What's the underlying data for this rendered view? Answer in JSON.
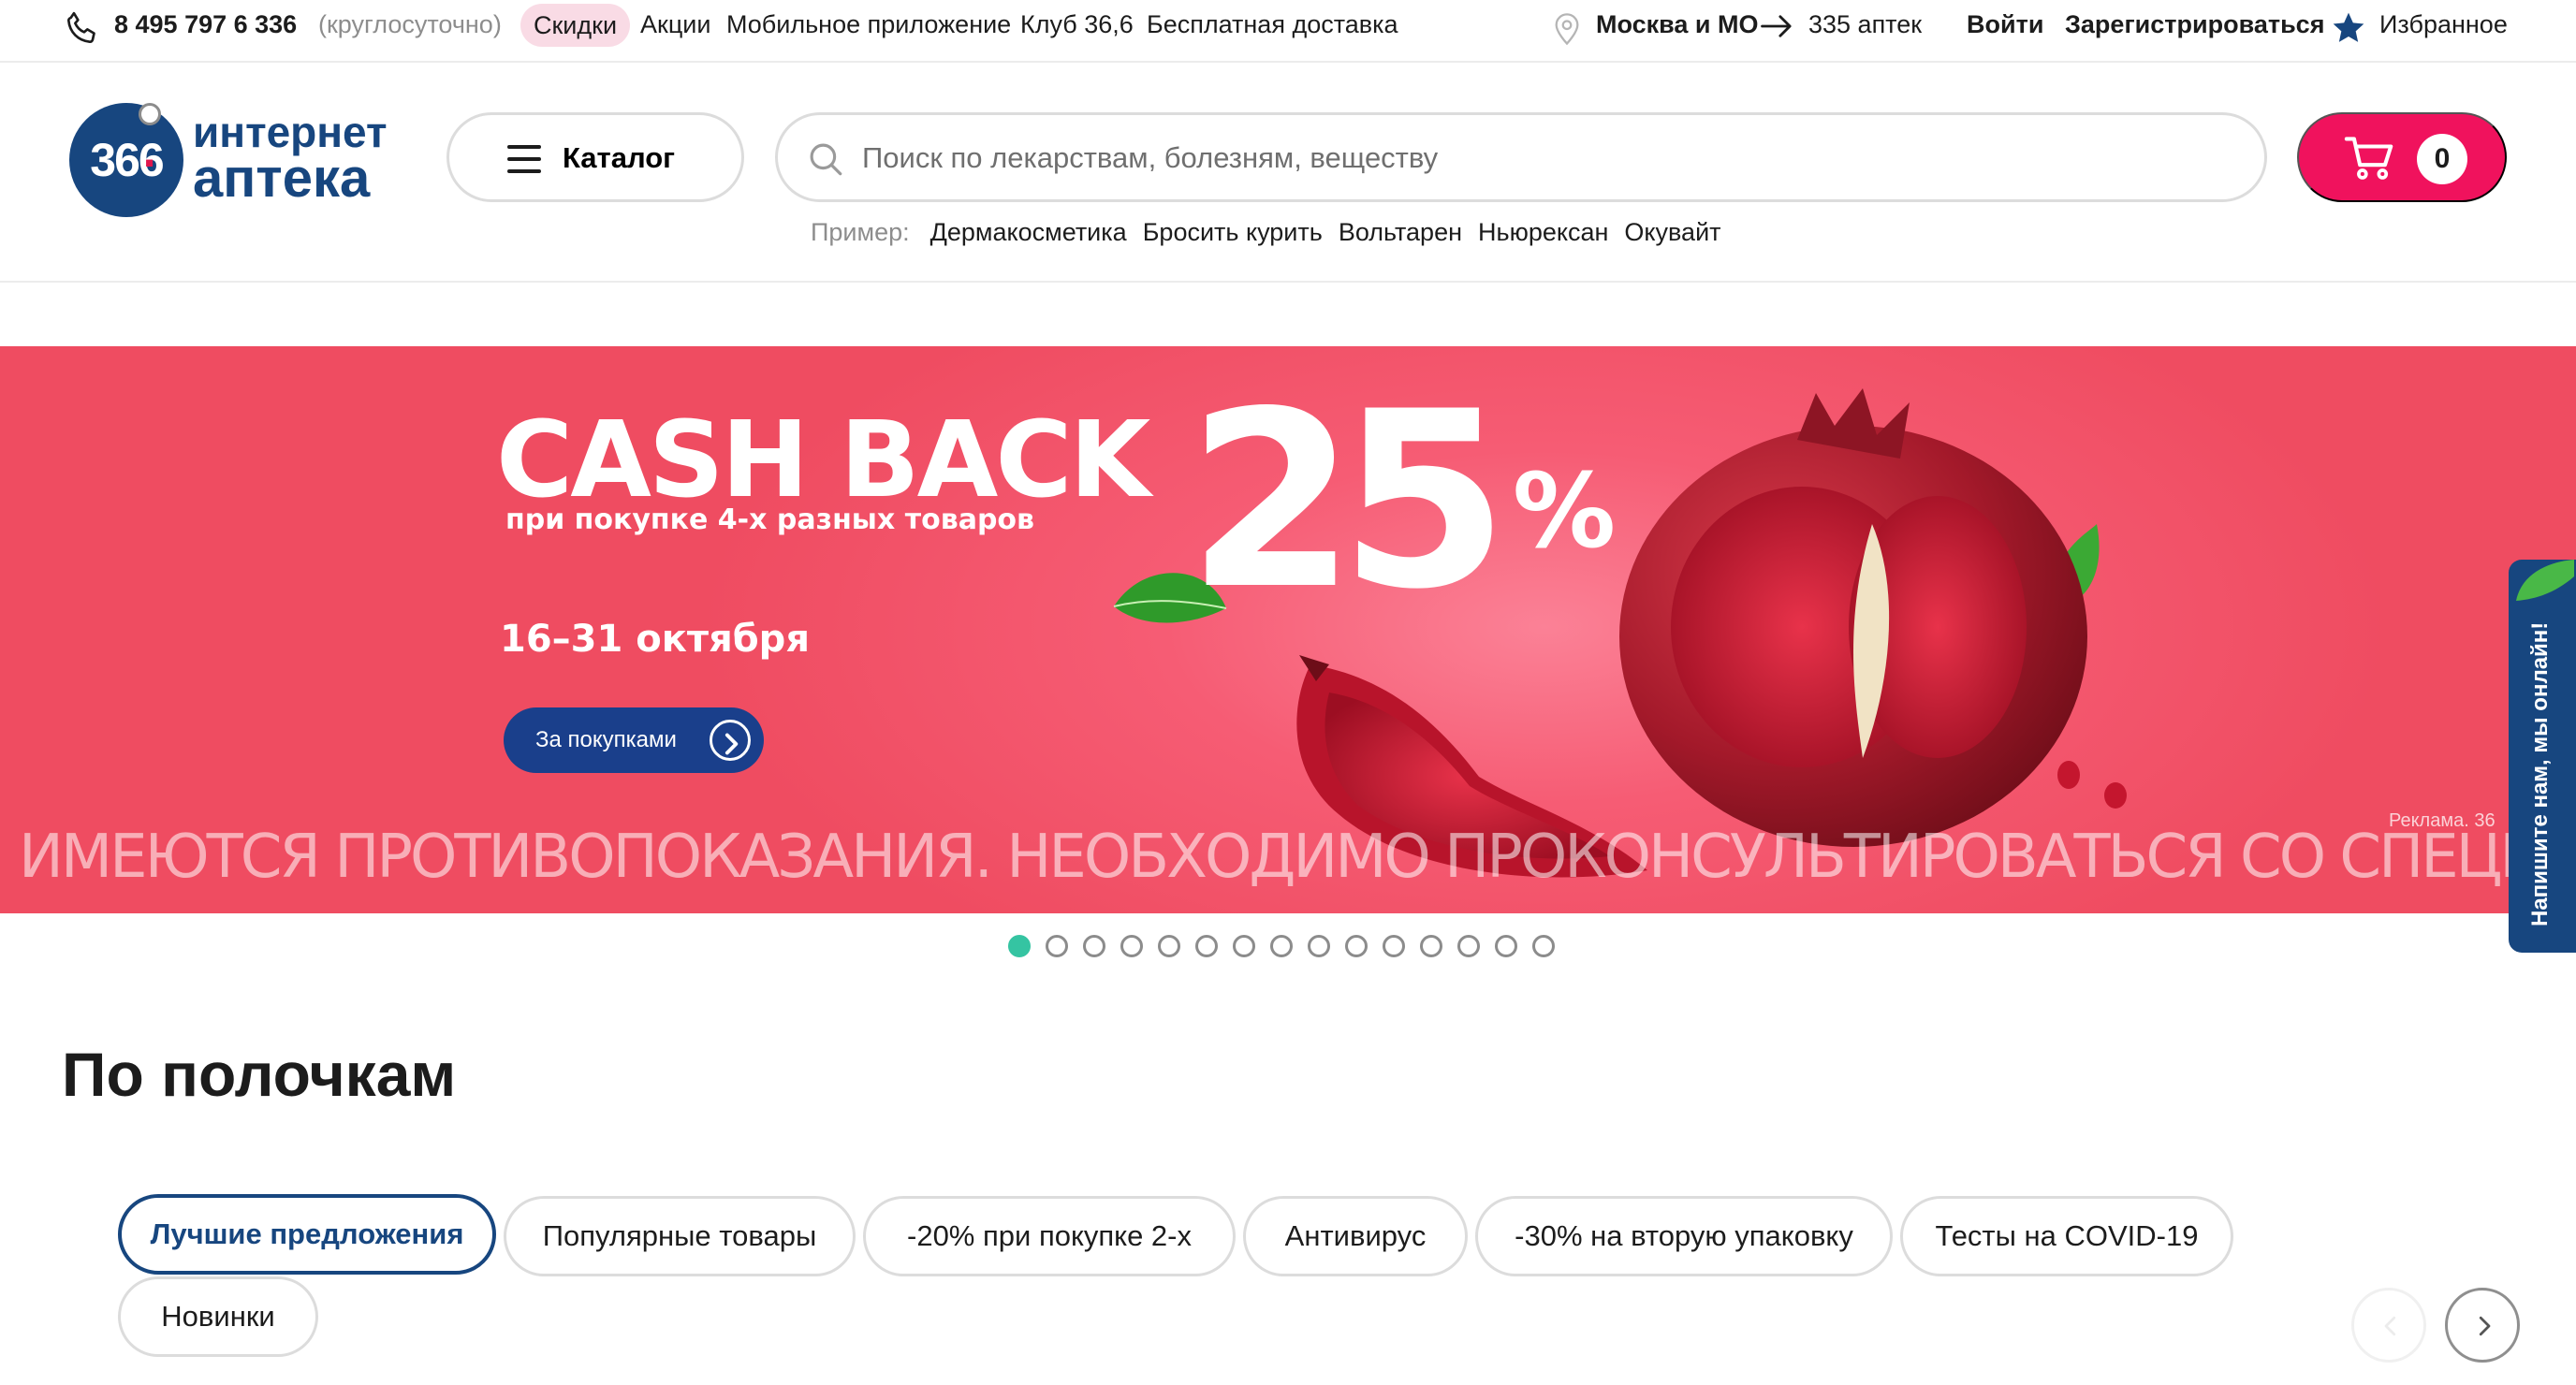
{
  "topbar": {
    "phone": "8 495 797 6 336",
    "phone_note": "(круглосуточно)",
    "links": {
      "discounts": "Скидки",
      "promos": "Акции",
      "app": "Мобильное приложение",
      "club": "Клуб 36,6",
      "delivery": "Бесплатная доставка"
    },
    "city": "Москва и МО",
    "pharmacies": "335 аптек",
    "login": "Войти",
    "register": "Зарегистрироваться",
    "favorites": "Избранное"
  },
  "header": {
    "logo": {
      "number_left": "36",
      "number_right": "6",
      "line1": "интернет",
      "line2": "аптека"
    },
    "catalog_label": "Каталог",
    "search_placeholder": "Поиск по лекарствам, болезням, веществу",
    "examples_label": "Пример:",
    "examples": [
      "Дермакосметика",
      "Бросить курить",
      "Вольтарен",
      "Ньюрексан",
      "Окувайт"
    ],
    "cart_count": "0"
  },
  "banner": {
    "headline": "CASH BACK",
    "subline": "при покупке 4-х разных товаров",
    "percent_value": "25",
    "percent_sign": "%",
    "dates": "16–31 октября",
    "cta": "За покупками",
    "disclaimer": "ИМЕЮТСЯ ПРОТИВОПОКАЗАНИЯ. НЕОБХОДИМО ПРОКОНСУЛЬТИРОВАТЬСЯ СО СПЕЦИАЛИСТО",
    "ad_label": "Реклама. 36",
    "slide_count": 15,
    "active_slide": 1
  },
  "chat_tab": "Напишите нам, мы онлайн!",
  "section": {
    "title": "По полочкам",
    "chips": [
      {
        "label": "Лучшие предложения",
        "active": true
      },
      {
        "label": "Популярные товары",
        "active": false
      },
      {
        "label": "-20% при покупке 2-х",
        "active": false
      },
      {
        "label": "Антивирус",
        "active": false
      },
      {
        "label": "-30% на вторую упаковку",
        "active": false
      },
      {
        "label": "Тесты на COVID-19",
        "active": false
      },
      {
        "label": "Новинки",
        "active": false
      }
    ]
  },
  "colors": {
    "brand_blue": "#17467f",
    "cart_pink": "#f0125d",
    "discount_pill": "#f9dbe5",
    "banner_red": "#ef4c61",
    "active_dot": "#35c4a2"
  },
  "icons": [
    "phone-icon",
    "location-pin-icon",
    "arrow-right-icon",
    "star-icon",
    "menu-icon",
    "search-icon",
    "cart-icon",
    "chevron-right-icon",
    "chevron-left-icon"
  ]
}
